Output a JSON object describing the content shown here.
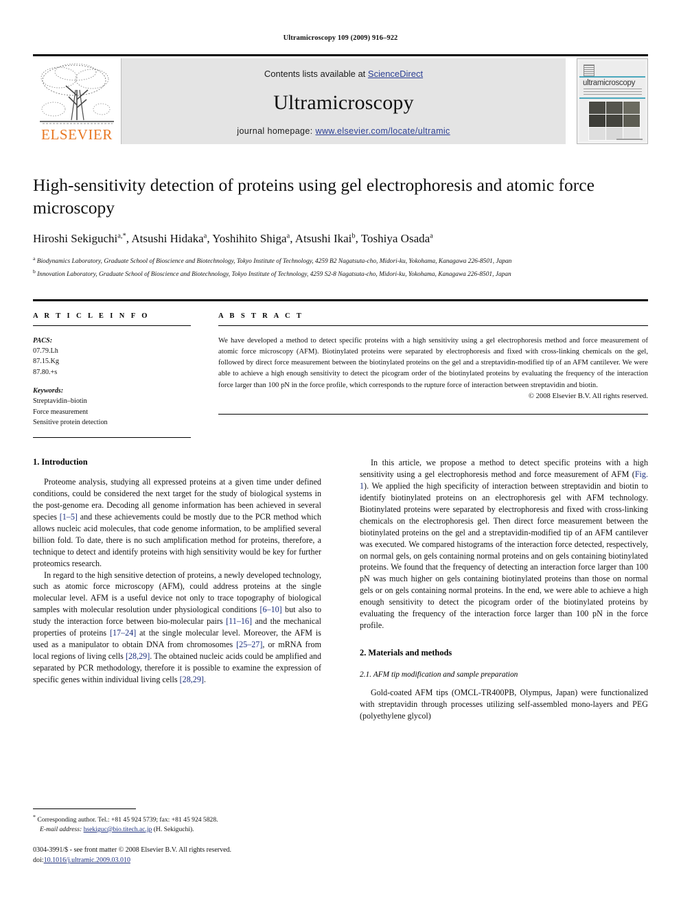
{
  "running_head": "Ultramicroscopy 109 (2009) 916–922",
  "masthead": {
    "publisher_word": "ELSEVIER",
    "contents_prefix": "Contents lists available at ",
    "contents_link": "ScienceDirect",
    "journal_title": "Ultramicroscopy",
    "homepage_prefix": "journal homepage: ",
    "homepage_url": "www.elsevier.com/locate/ultramic",
    "cover_journal_name": "ultramicroscopy"
  },
  "title": "High-sensitivity detection of proteins using gel electrophoresis and atomic force microscopy",
  "authors": "Hiroshi Sekiguchi a,*, Atsushi Hidaka a, Yoshihito Shiga a, Atsushi Ikai b, Toshiya Osada a",
  "affiliations": [
    "a Biodynamics Laboratory, Graduate School of Bioscience and Biotechnology, Tokyo Institute of Technology, 4259 B2 Nagatsuta-cho, Midori-ku, Yokohama, Kanagawa 226-8501, Japan",
    "b Innovation Laboratory, Graduate School of Bioscience and Biotechnology, Tokyo Institute of Technology, 4259 S2-8 Nagatsuta-cho, Midori-ku, Yokohama, Kanagawa 226-8501, Japan"
  ],
  "article_info": {
    "heading": "A R T I C L E  I N F O",
    "pacs_label": "PACS:",
    "pacs_codes": [
      "07.79.Lh",
      "87.15.Kg",
      "87.80.+s"
    ],
    "keywords_label": "Keywords:",
    "keywords": [
      "Streptavidin–biotin",
      "Force measurement",
      "Sensitive protein detection"
    ]
  },
  "abstract": {
    "heading": "A B S T R A C T",
    "text": "We have developed a method to detect specific proteins with a high sensitivity using a gel electrophoresis method and force measurement of atomic force microscopy (AFM). Biotinylated proteins were separated by electrophoresis and fixed with cross-linking chemicals on the gel, followed by direct force measurement between the biotinylated proteins on the gel and a streptavidin-modified tip of an AFM cantilever. We were able to achieve a high enough sensitivity to detect the picogram order of the biotinylated proteins by evaluating the frequency of the interaction force larger than 100 pN in the force profile, which corresponds to the rupture force of interaction between streptavidin and biotin.",
    "copyright": "© 2008 Elsevier B.V. All rights reserved."
  },
  "sections": {
    "intro_heading": "1.  Introduction",
    "intro_p1_a": "Proteome analysis, studying all expressed proteins at a given time under defined conditions, could be considered the next target for the study of biological systems in the post-genome era. Decoding all genome information has been achieved in several species ",
    "intro_p1_ref1": "[1–5]",
    "intro_p1_b": " and these achievements could be mostly due to the PCR method which allows nucleic acid molecules, that code genome information, to be amplified several billion fold. To date, there is no such amplification method for proteins, therefore, a technique to detect and identify proteins with high sensitivity would be key for further proteomics research.",
    "intro_p2_a": "In regard to the high sensitive detection of proteins, a newly developed technology, such as atomic force microscopy (AFM), could address proteins at the single molecular level. AFM is a useful device not only to trace topography of biological samples with molecular resolution under physiological conditions ",
    "intro_p2_ref1": "[6–10]",
    "intro_p2_b": " but also to study the interaction force between bio-molecular pairs ",
    "intro_p2_ref2": "[11–16]",
    "intro_p2_c": " and the mechanical properties of proteins ",
    "intro_p2_ref3": "[17–24]",
    "intro_p2_d": " at the single molecular level. Moreover, the AFM is used as a manipulator to obtain DNA from chromosomes ",
    "intro_p2_ref4": "[25–27]",
    "intro_p2_e": ", or mRNA from local regions of living cells ",
    "intro_p2_ref5": "[28,29]",
    "intro_p2_f": ". The obtained nucleic acids could be amplified and separated by PCR methodology, therefore it is possible to examine the expression of specific genes within individual living cells ",
    "intro_p2_ref6": "[28,29]",
    "intro_p2_g": ".",
    "right_p1_a": "In this article, we propose a method to detect specific proteins with a high sensitivity using a gel electrophoresis method and force measurement of AFM (",
    "right_p1_ref1": "Fig. 1",
    "right_p1_b": "). We applied the high specificity of interaction between streptavidin and biotin to identify biotinylated proteins on an electrophoresis gel with AFM technology. Biotinylated proteins were separated by electrophoresis and fixed with cross-linking chemicals on the electrophoresis gel. Then direct force measurement between the biotinylated proteins on the gel and a streptavidin-modified tip of an AFM cantilever was executed. We compared histograms of the interaction force detected, respectively, on normal gels, on gels containing normal proteins and on gels containing biotinylated proteins. We found that the frequency of detecting an interaction force larger than 100 pN was much higher on gels containing biotinylated proteins than those on normal gels or on gels containing normal proteins. In the end, we were able to achieve a high enough sensitivity to detect the picogram order of the biotinylated proteins by evaluating the frequency of the interaction force larger than 100 pN in the force profile.",
    "materials_heading": "2.  Materials and methods",
    "subsec_2_1": "2.1.  AFM tip modification and sample preparation",
    "materials_p1": "Gold-coated AFM tips (OMCL-TR400PB, Olympus, Japan) were functionalized with streptavidin through processes utilizing self-assembled mono-layers and PEG (polyethylene glycol)"
  },
  "footnotes": {
    "corresponding_star": "*",
    "corresponding": " Corresponding author. Tel.: +81 45 924 5739; fax: +81 45 924 5828.",
    "email_label": "E-mail address:",
    "email": "hsekiguc@bio.titech.ac.jp",
    "email_suffix": " (H. Sekiguchi).",
    "imprint_line1_a": "0304-3991/$ - see front matter © 2008 Elsevier B.V. All rights reserved.",
    "doi_label": "doi:",
    "doi_value": "10.1016/j.ultramic.2009.03.010"
  },
  "colors": {
    "link": "#2b3f94",
    "reference": "#1c2f7d",
    "elsevier_orange": "#E87722",
    "band_gray": "#e4e4e4",
    "cover_teal": "#4aa8bd"
  }
}
